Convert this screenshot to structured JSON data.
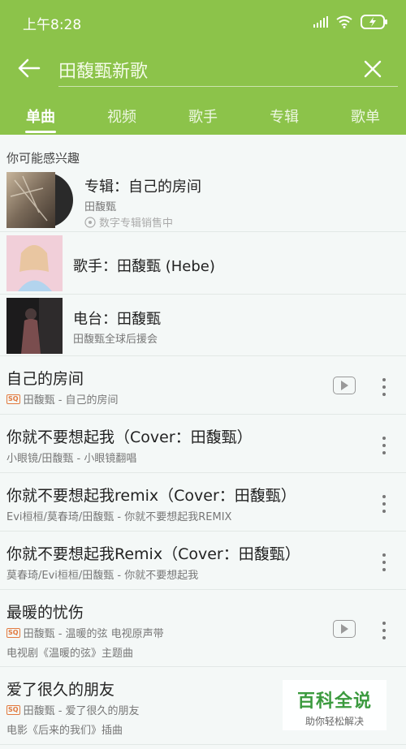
{
  "status_bar": {
    "time": "上午8:28"
  },
  "search": {
    "query": "田馥甄新歌"
  },
  "tabs": [
    {
      "label": "单曲",
      "active": true
    },
    {
      "label": "视频"
    },
    {
      "label": "歌手"
    },
    {
      "label": "专辑"
    },
    {
      "label": "歌单"
    }
  ],
  "suggestions": {
    "title": "你可能感兴趣",
    "items": [
      {
        "title": "专辑：自己的房间",
        "sub1": "田馥甄",
        "sub2": "数字专辑销售中"
      },
      {
        "title": "歌手：田馥甄 (Hebe)"
      },
      {
        "title": "电台：田馥甄",
        "sub1": "田馥甄全球后援会"
      }
    ]
  },
  "songs": [
    {
      "title": "自己的房间",
      "meta": "田馥甄 - 自己的房间",
      "sq": "SQ",
      "has_mv": true
    },
    {
      "title": "你就不要想起我（Cover：田馥甄）",
      "meta": "小眼镜/田馥甄 - 小眼镜翻唱"
    },
    {
      "title": "你就不要想起我remix（Cover：田馥甄）",
      "meta": "Evi桓桓/莫春琦/田馥甄 - 你就不要想起我REMIX"
    },
    {
      "title": "你就不要想起我Remix（Cover：田馥甄）",
      "meta": "莫春琦/Evi桓桓/田馥甄 - 你就不要想起我"
    },
    {
      "title": "最暖的忧伤",
      "meta": "田馥甄 - 温暖的弦 电视原声带",
      "sq": "SQ",
      "has_mv": true,
      "extra": "电视剧《温暖的弦》主题曲"
    },
    {
      "title": "爱了很久的朋友",
      "meta": "田馥甄 - 爱了很久的朋友",
      "sq": "SQ",
      "extra": "电影《后来的我们》插曲"
    }
  ],
  "watermark": {
    "title": "百科全说",
    "subtitle": "助你轻松解决"
  },
  "colors": {
    "accent": "#8cc34a",
    "sq_badge": "#e27a3f",
    "watermark": "#3b9a3e"
  }
}
